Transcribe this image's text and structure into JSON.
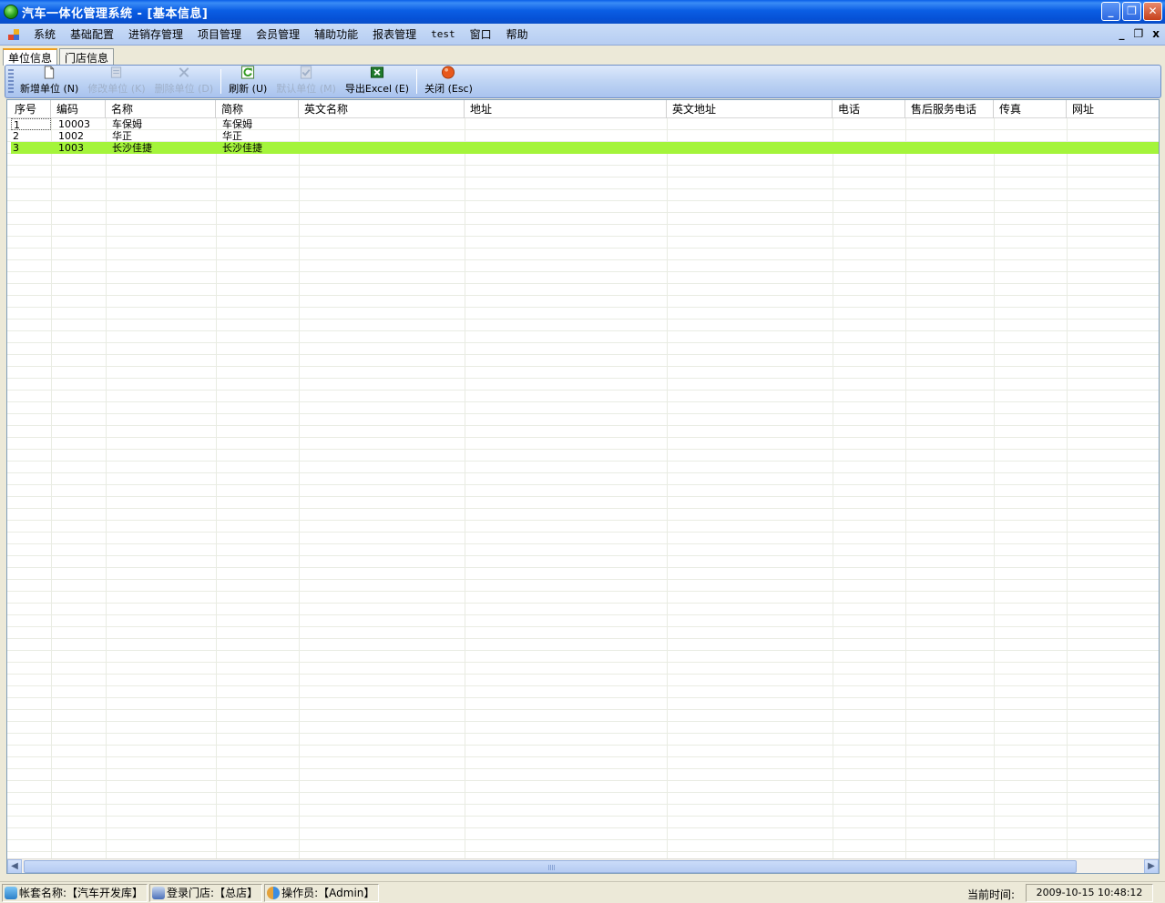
{
  "window": {
    "title": "汽车一体化管理系统 - [基本信息]",
    "controls": [
      "minimize",
      "restore",
      "close"
    ]
  },
  "menu": {
    "items": [
      "系统",
      "基础配置",
      "进销存管理",
      "项目管理",
      "会员管理",
      "辅助功能",
      "报表管理",
      "test",
      "窗口",
      "帮助"
    ],
    "mdi": {
      "minimize": "_",
      "restore": "❐",
      "close": "x"
    }
  },
  "tabs": [
    {
      "label": "单位信息",
      "active": true
    },
    {
      "label": "门店信息",
      "active": false
    }
  ],
  "toolbar": {
    "add": {
      "label": "新增单位",
      "key": "(N)",
      "enabled": true,
      "icon": "new-document-icon"
    },
    "edit": {
      "label": "修改单位",
      "key": "(K)",
      "enabled": false,
      "icon": "edit-document-icon"
    },
    "delete": {
      "label": "删除单位",
      "key": "(D)",
      "enabled": false,
      "icon": "delete-icon"
    },
    "refresh": {
      "label": "刷新",
      "key": "(U)",
      "enabled": true,
      "icon": "refresh-icon"
    },
    "default": {
      "label": "默认单位",
      "key": "(M)",
      "enabled": false,
      "icon": "checkmark-icon"
    },
    "export": {
      "label": "导出Excel",
      "key": "(E)",
      "enabled": true,
      "icon": "excel-icon"
    },
    "close": {
      "label": "关闭",
      "key": "(Esc)",
      "enabled": true,
      "icon": "close-circle-icon"
    }
  },
  "grid": {
    "columns": [
      "序号",
      "编码",
      "名称",
      "简称",
      "英文名称",
      "地址",
      "英文地址",
      "电话",
      "售后服务电话",
      "传真",
      "网址"
    ],
    "rows": [
      {
        "cells": [
          "1",
          "10003",
          "车保姆",
          "车保姆",
          "",
          "",
          "",
          "",
          "",
          "",
          ""
        ],
        "selected": false
      },
      {
        "cells": [
          "2",
          "1002",
          "华正",
          "华正",
          "",
          "",
          "",
          "",
          "",
          "",
          ""
        ],
        "selected": false
      },
      {
        "cells": [
          "3",
          "1003",
          "长沙佳捷",
          "长沙佳捷",
          "",
          "",
          "",
          "",
          "",
          "",
          ""
        ],
        "selected": true
      }
    ],
    "selected_color": "#a4f43b"
  },
  "status": {
    "account": "帐套名称:【汽车开发库】",
    "store": "登录门店:【总店】",
    "operator": "操作员:【Admin】",
    "time_label": "当前时间:",
    "time_value": "2009-10-15 10:48:12"
  }
}
